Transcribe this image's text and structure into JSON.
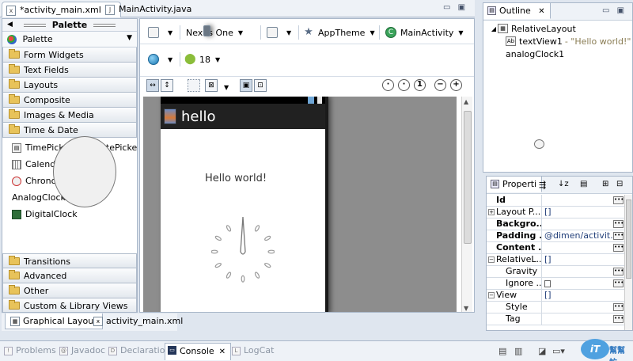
{
  "editor_tabs": [
    {
      "label": "*activity_main.xml",
      "icon": "xml-file-icon",
      "active": true
    },
    {
      "label": "MainActivity.java",
      "icon": "java-file-icon",
      "active": false
    }
  ],
  "palette": {
    "title": "Palette",
    "selector": "Palette",
    "categories_top": [
      "Form Widgets",
      "Text Fields",
      "Layouts",
      "Composite",
      "Images & Media",
      "Time & Date"
    ],
    "widgets": [
      [
        "TimePicker",
        "DatePicker"
      ],
      [
        "CalendarView"
      ],
      [
        "Chronometer"
      ],
      [
        "AnalogClock"
      ],
      [
        "DigitalClock"
      ]
    ],
    "categories_bottom": [
      "Transitions",
      "Advanced",
      "Other",
      "Custom & Library Views"
    ]
  },
  "bottom_tabs": [
    "Graphical Layout",
    "activity_main.xml"
  ],
  "toolbar": {
    "device": "Nexus One",
    "theme": "AppTheme",
    "activity": "MainActivity",
    "api_level": "18"
  },
  "device_preview": {
    "app_title": "hello",
    "text": "Hello world!"
  },
  "outline": {
    "tab": "Outline",
    "root": "RelativeLayout",
    "children": [
      {
        "name": "textView1",
        "hint": "- \"Hello world!\"",
        "icon": "text-view-icon"
      },
      {
        "name": "analogClock1",
        "hint": "",
        "icon": "analog-clock-icon"
      }
    ]
  },
  "properties": {
    "tab": "Properti",
    "rows": [
      {
        "name": "Id",
        "value": "",
        "bold": true,
        "expand": "",
        "more": true
      },
      {
        "name": "Layout P...",
        "value": "[]",
        "bold": false,
        "expand": "+",
        "more": false
      },
      {
        "name": "Backgro...",
        "value": "",
        "bold": true,
        "expand": "",
        "more": true
      },
      {
        "name": "Padding ...",
        "value": "@dimen/activit...",
        "bold": true,
        "expand": "",
        "more": true
      },
      {
        "name": "Content ...",
        "value": "",
        "bold": true,
        "expand": "",
        "more": true
      },
      {
        "name": "RelativeL...",
        "value": "[]",
        "bold": false,
        "expand": "−",
        "more": false
      },
      {
        "name": "Gravity",
        "value": "",
        "bold": false,
        "expand": "",
        "more": true,
        "indent": true
      },
      {
        "name": "Ignore ...",
        "value": "",
        "bold": false,
        "expand": "",
        "more": true,
        "indent": true,
        "checkbox": true
      },
      {
        "name": "View",
        "value": "[]",
        "bold": false,
        "expand": "−",
        "more": false
      },
      {
        "name": "Style",
        "value": "",
        "bold": false,
        "expand": "",
        "more": true,
        "indent": true
      },
      {
        "name": "Tag",
        "value": "",
        "bold": false,
        "expand": "",
        "more": true,
        "indent": true
      }
    ]
  },
  "bottom_views": [
    {
      "label": "Problems",
      "icon": "problems-icon",
      "active": false
    },
    {
      "label": "Javadoc",
      "icon": "javadoc-icon",
      "active": false
    },
    {
      "label": "Declaration",
      "icon": "declaration-icon",
      "active": false
    },
    {
      "label": "Console",
      "icon": "console-icon",
      "active": true
    },
    {
      "label": "LogCat",
      "icon": "logcat-icon",
      "active": false
    }
  ],
  "watermark": {
    "logo": "iT",
    "text": "幫幫忙"
  },
  "colors": {
    "accent": "#243659",
    "panel_border": "#a9b7c9"
  }
}
